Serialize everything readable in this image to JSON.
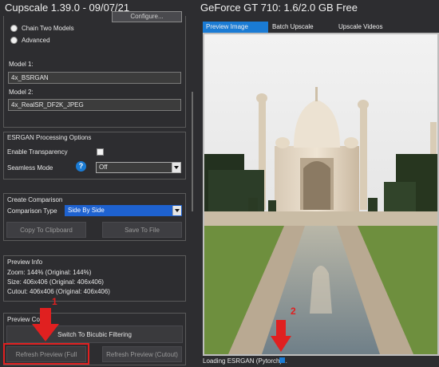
{
  "app": {
    "left_title": "Cupscale 1.39.0 - 09/07/21",
    "right_title": "GeForce GT 710: 1.6/2.0 GB Free"
  },
  "model_section": {
    "configure_label": "Configure...",
    "radio_chain": "Chain Two Models",
    "radio_advanced": "Advanced",
    "model1_label": "Model 1:",
    "model1_value": "4x_BSRGAN",
    "model2_label": "Model 2:",
    "model2_value": "4x_RealSR_DF2K_JPEG"
  },
  "esrgan": {
    "title": "ESRGAN Processing Options",
    "transparency_label": "Enable Transparency",
    "seamless_label": "Seamless Mode",
    "help_glyph": "?",
    "seamless_value": "Off"
  },
  "comparison": {
    "title": "Create Comparison",
    "type_label": "Comparison Type",
    "type_value": "Side By Side",
    "copy_button": "Copy To Clipboard",
    "save_button": "Save To File"
  },
  "preview_info": {
    "title": "Preview Info",
    "zoom": "Zoom: 144% (Original: 144%)",
    "size": "Size: 406x406 (Original: 406x406)",
    "cutout": "Cutout: 406x406 (Original: 406x406)"
  },
  "preview_controls": {
    "title": "Preview Co",
    "switch_button": "Switch To Bicubic Filtering",
    "refresh_full": "Refresh Preview (Full Image)",
    "refresh_cutout": "Refresh Preview (Cutout)"
  },
  "tabs": [
    "Preview Image",
    "Batch Upscale",
    "Upscale Videos"
  ],
  "status": {
    "text": "Loading ESRGAN (Pytorch)...",
    "progress": 0.05
  },
  "annotations": {
    "marker1": "1",
    "marker2": "2"
  },
  "colors": {
    "accent": "#1a7bd4",
    "annotation": "#e02020",
    "panel": "#2d2d30"
  }
}
